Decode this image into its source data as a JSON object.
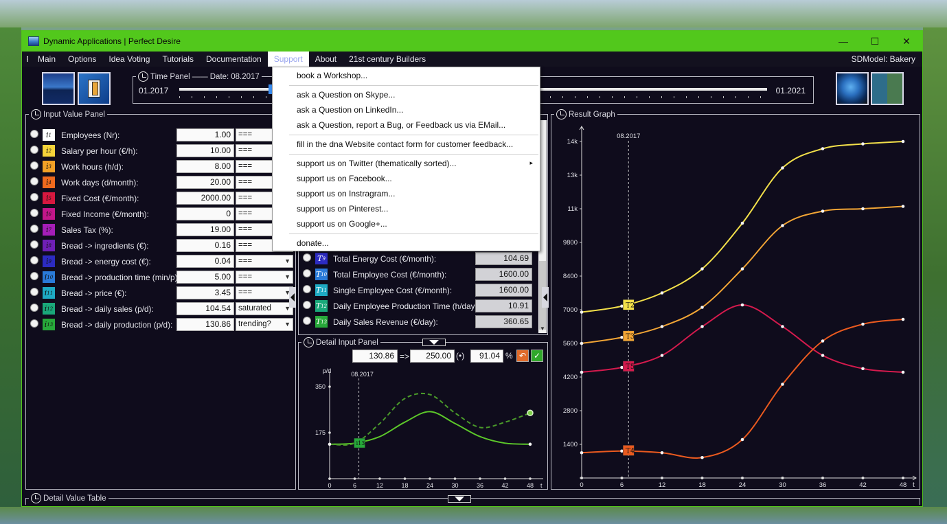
{
  "window": {
    "title": "Dynamic Applications | Perfect Desire",
    "controls": {
      "minimize": "—",
      "maximize": "☐",
      "close": "✕"
    },
    "accent_color": "#52c81c"
  },
  "menubar": {
    "items": [
      "Main",
      "Options",
      "Idea Voting",
      "Tutorials",
      "Documentation",
      "Support",
      "About",
      "21st century Builders"
    ],
    "active": "Support",
    "sdmodel_label": "SDModel:",
    "sdmodel_value": "Bakery"
  },
  "time_panel": {
    "title": "Time Panel",
    "date_label": "Date:",
    "date_value": "08.2017",
    "start": "01.2017",
    "end": "01.2021",
    "position_fraction": 0.155
  },
  "support_menu": {
    "items": [
      "book a Workshop...",
      "ask a Question on Skype...",
      "ask a Question on LinkedIn...",
      "ask a Question, report a Bug, or Feedback us via EMail...",
      "fill in the dna Website contact form for customer feedback...",
      "support us on Twitter (thematically sorted)...",
      "support us on Facebook...",
      "support us on Instragram...",
      "support us on Pinterest...",
      "support us on Google+...",
      "donate..."
    ],
    "submenu_arrow": "▸"
  },
  "input_panel": {
    "title": "Input Value Panel",
    "rows": [
      {
        "sub": "1",
        "label": "Employees (Nr):",
        "value": "1.00",
        "mode": "===",
        "color": "#ffffff"
      },
      {
        "sub": "2",
        "label": "Salary per hour (€/h):",
        "value": "10.00",
        "mode": "===",
        "color": "#f5d33a"
      },
      {
        "sub": "3",
        "label": "Work hours (h/d):",
        "value": "8.00",
        "mode": "===",
        "color": "#f3a126"
      },
      {
        "sub": "4",
        "label": "Work days (d/month):",
        "value": "20.00",
        "mode": "===",
        "color": "#ef6a1e"
      },
      {
        "sub": "5",
        "label": "Fixed Cost (€/month):",
        "value": "2000.00",
        "mode": "===",
        "color": "#d6183f"
      },
      {
        "sub": "6",
        "label": "Fixed Income (€/month):",
        "value": "0",
        "mode": "===",
        "color": "#c2168a"
      },
      {
        "sub": "7",
        "label": "Sales Tax (%):",
        "value": "19.00",
        "mode": "===",
        "color": "#a51eb8"
      },
      {
        "sub": "8",
        "label": "Bread -> ingredients (€):",
        "value": "0.16",
        "mode": "===",
        "color": "#6f1fb6"
      },
      {
        "sub": "9",
        "label": "Bread -> energy cost (€):",
        "value": "0.04",
        "mode": "===",
        "color": "#2c2bc1"
      },
      {
        "sub": "10",
        "label": "Bread -> production time (min/p):",
        "value": "5.00",
        "mode": "===",
        "color": "#2a7ad8"
      },
      {
        "sub": "11",
        "label": "Bread -> price (€):",
        "value": "3.45",
        "mode": "===",
        "color": "#1ea9c3"
      },
      {
        "sub": "12",
        "label": "Bread -> daily sales (p/d):",
        "value": "104.54",
        "mode": "saturated",
        "color": "#1aa87a"
      },
      {
        "sub": "13",
        "label": "Bread -> daily production (p/d):",
        "value": "130.86",
        "mode": "trending?",
        "color": "#27a83a"
      }
    ]
  },
  "output_panel": {
    "rows": [
      {
        "sub": "9",
        "label": "Total Energy Cost (€/month):",
        "value": "104.69",
        "color": "#2c2bc1"
      },
      {
        "sub": "10",
        "label": "Total Employee Cost (€/month):",
        "value": "1600.00",
        "color": "#2a7ad8"
      },
      {
        "sub": "11",
        "label": "Single Employee Cost (€/month):",
        "value": "1600.00",
        "color": "#1ea9c3"
      },
      {
        "sub": "12",
        "label": "Daily Employee Production Time (h/day):",
        "value": "10.91",
        "color": "#1aa87a"
      },
      {
        "sub": "13",
        "label": "Daily Sales Revenue (€/day):",
        "value": "360.65",
        "color": "#27a83a"
      }
    ]
  },
  "detail_input": {
    "title": "Detail Input Panel",
    "from_value": "130.86",
    "arrow": "=>",
    "to_value": "250.00",
    "mode_symbol": "(•)",
    "percent_value": "91.04",
    "percent_sign": "%",
    "ylabel": "p/d",
    "xlabel": "t",
    "marker_date": "08.2017",
    "chip": "i13",
    "y_ticks": [
      "350",
      "175",
      "0"
    ],
    "x_ticks": [
      "0",
      "6",
      "12",
      "18",
      "24",
      "30",
      "36",
      "42",
      "48"
    ]
  },
  "result_graph": {
    "title": "Result Graph",
    "marker_date": "08.2017",
    "xlabel": "t",
    "y_ticks": [
      "14k",
      "13k",
      "11k",
      "9800",
      "8400",
      "7000",
      "5600",
      "4200",
      "2800",
      "1400",
      "0"
    ],
    "x_ticks": [
      "0",
      "6",
      "12",
      "18",
      "24",
      "30",
      "36",
      "42",
      "48"
    ]
  },
  "detail_table": {
    "title": "Detail Value Table"
  },
  "chart_data": [
    {
      "type": "line",
      "title": "Result Graph",
      "xlabel": "t",
      "ylabel": "",
      "x": [
        0,
        6,
        12,
        18,
        24,
        30,
        36,
        42,
        48
      ],
      "xlim": [
        0,
        48
      ],
      "ylim": [
        0,
        14000
      ],
      "series": [
        {
          "name": "T2",
          "color": "#f3e04a",
          "values": [
            6900,
            7150,
            7700,
            8700,
            10600,
            12900,
            13700,
            13900,
            14000
          ]
        },
        {
          "name": "T3",
          "color": "#f2a535",
          "values": [
            5600,
            5850,
            6300,
            7100,
            8700,
            10500,
            11100,
            11200,
            11300
          ]
        },
        {
          "name": "T5",
          "color": "#d41a4d",
          "values": [
            4400,
            4600,
            5100,
            6300,
            7200,
            6300,
            5100,
            4550,
            4400
          ]
        },
        {
          "name": "T4",
          "color": "#ea5a1f",
          "values": [
            1050,
            1120,
            1050,
            850,
            1600,
            3900,
            5700,
            6400,
            6600
          ]
        }
      ],
      "grid": false,
      "marker_x": 7
    },
    {
      "type": "line",
      "title": "Detail Input Panel",
      "xlabel": "t",
      "ylabel": "p/d",
      "x": [
        0,
        6,
        12,
        18,
        24,
        30,
        36,
        42,
        48
      ],
      "xlim": [
        0,
        48
      ],
      "ylim": [
        0,
        350
      ],
      "series": [
        {
          "name": "",
          "color": "#5cc82a",
          "style": "solid",
          "values": [
            131,
            135,
            160,
            215,
            255,
            210,
            160,
            135,
            131
          ]
        },
        {
          "name": "",
          "color": "#4a9a2a",
          "style": "dashed",
          "values": [
            131,
            135,
            210,
            305,
            320,
            250,
            195,
            215,
            250
          ]
        }
      ],
      "marker_x": 7
    }
  ]
}
